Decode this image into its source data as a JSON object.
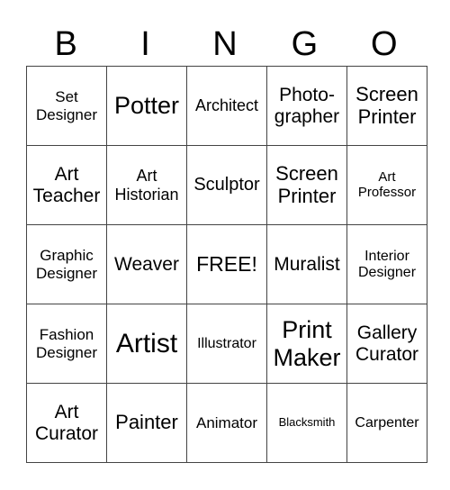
{
  "header": [
    "B",
    "I",
    "N",
    "G",
    "O"
  ],
  "rows": [
    [
      "Set\nDesigner",
      "Potter",
      "Architect",
      "Photo-\ngrapher",
      "Screen\nPrinter"
    ],
    [
      "Art\nTeacher",
      "Art\nHistorian",
      "Sculptor",
      "Screen\nPrinter",
      "Art\nProfessor"
    ],
    [
      "Graphic\nDesigner",
      "Weaver",
      "FREE!",
      "Muralist",
      "Interior\nDesigner"
    ],
    [
      "Fashion\nDesigner",
      "Artist",
      "Illustrator",
      "Print\nMaker",
      "Gallery\nCurator"
    ],
    [
      "Art\nCurator",
      "Painter",
      "Animator",
      "Blacksmith",
      "Carpenter"
    ]
  ]
}
